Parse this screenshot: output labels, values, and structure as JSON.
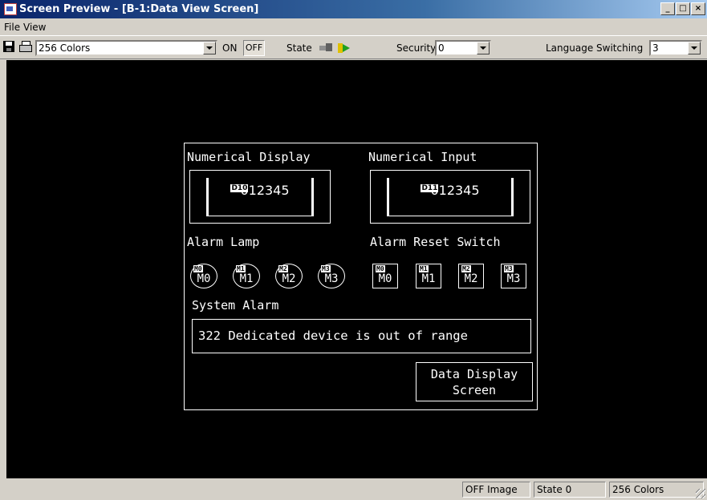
{
  "window": {
    "title": "Screen Preview - [B-1:Data View Screen]",
    "minimize": "_",
    "maximize": "□",
    "close": "×"
  },
  "menu": {
    "items": [
      "File",
      "View"
    ]
  },
  "toolbar": {
    "colors_select": "256 Colors",
    "on_label": "ON",
    "off_label": "OFF",
    "state_label": "State",
    "security_label": "Security",
    "security_value": "0",
    "language_label": "Language Switching",
    "language_value": "3"
  },
  "screen": {
    "numerical_display": {
      "label": "Numerical Display",
      "device": "D10",
      "value": "012345"
    },
    "numerical_input": {
      "label": "Numerical Input",
      "device": "D11",
      "value": "012345"
    },
    "alarm_lamp": {
      "label": "Alarm Lamp",
      "items": [
        "M0",
        "M1",
        "M2",
        "M3"
      ]
    },
    "alarm_reset_switch": {
      "label": "Alarm Reset Switch",
      "items": [
        "M0",
        "M1",
        "M2",
        "M3"
      ]
    },
    "system_alarm": {
      "label": "System Alarm",
      "message": "322 Dedicated device is out of range"
    },
    "data_display_button": {
      "line1": "Data Display",
      "line2": "Screen"
    }
  },
  "status": {
    "image": "OFF Image",
    "state": "State 0",
    "colors": "256 Colors"
  }
}
